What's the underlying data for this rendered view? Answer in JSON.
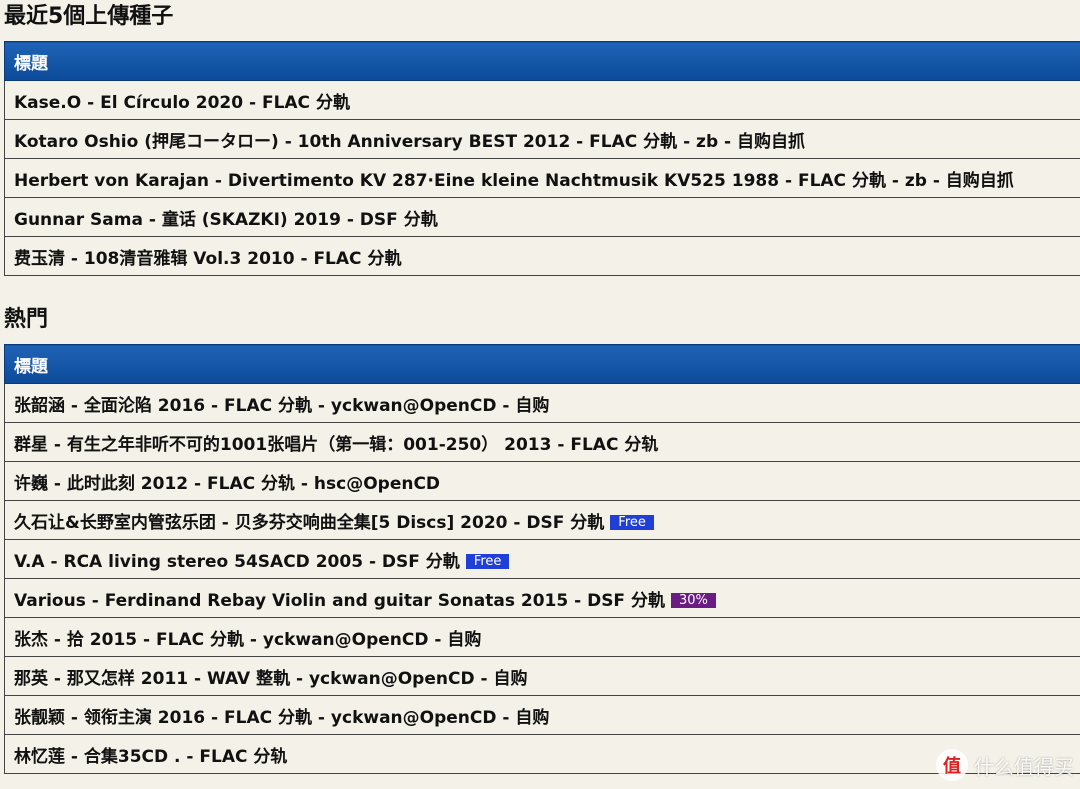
{
  "recent": {
    "title": "最近5個上傳種子",
    "column_header": "標題",
    "rows": [
      {
        "text": "Kase.O - El Círculo 2020 - FLAC 分軌",
        "tag": null
      },
      {
        "text": "Kotaro Oshio (押尾コータロー) - 10th Anniversary BEST 2012 - FLAC 分軌 - zb - 自购自抓",
        "tag": null
      },
      {
        "text": "Herbert von Karajan - Divertimento KV 287·Eine kleine Nachtmusik KV525 1988 - FLAC 分軌 - zb - 自购自抓",
        "tag": null
      },
      {
        "text": "Gunnar Sama - 童话 (SKAZKI) 2019 - DSF 分軌",
        "tag": null
      },
      {
        "text": "费玉清 - 108清音雅辑 Vol.3 2010 - FLAC 分軌",
        "tag": null
      }
    ]
  },
  "hot": {
    "title": "熱門",
    "column_header": "標題",
    "rows": [
      {
        "text": "张韶涵 - 全面沦陷 2016 - FLAC 分軌 - yckwan@OpenCD - 自购",
        "tag": null
      },
      {
        "text": "群星 - 有生之年非听不可的1001张唱片（第一辑：001-250） 2013 - FLAC 分轨",
        "tag": null
      },
      {
        "text": "许巍 - 此时此刻 2012 - FLAC 分轨 - hsc@OpenCD",
        "tag": null
      },
      {
        "text": "久石让&长野室内管弦乐团 - 贝多芬交响曲全集[5 Discs] 2020 - DSF 分軌",
        "tag": "Free"
      },
      {
        "text": "V.A - RCA living stereo 54SACD 2005 - DSF 分軌",
        "tag": "Free"
      },
      {
        "text": "Various - Ferdinand Rebay Violin and guitar Sonatas 2015 - DSF 分軌",
        "tag": "30%"
      },
      {
        "text": "张杰 - 拾 2015 - FLAC 分軌 - yckwan@OpenCD - 自购",
        "tag": null
      },
      {
        "text": "那英 - 那又怎样 2011 - WAV 整軌 - yckwan@OpenCD - 自购",
        "tag": null
      },
      {
        "text": "张靓颖 - 领衔主演 2016 - FLAC 分軌 - yckwan@OpenCD - 自购",
        "tag": null
      },
      {
        "text": "林忆莲 - 合集35CD . - FLAC 分轨",
        "tag": null
      }
    ]
  },
  "watermark": {
    "logo": "值",
    "text": "什么值得买"
  },
  "colors": {
    "header_blue": "#0c4a99",
    "tag_free": "#1f3fd6",
    "tag_30": "#6a1c82",
    "background": "#f4f2e8"
  }
}
